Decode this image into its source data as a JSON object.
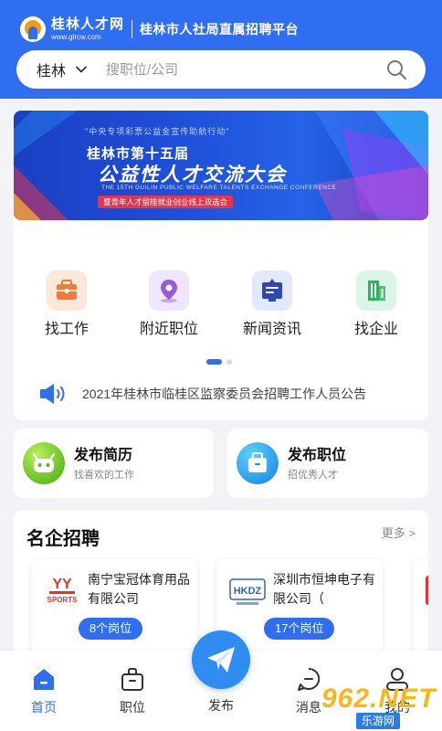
{
  "header": {
    "logo_name": "桂林人才网",
    "logo_url": "www.glrcw.com",
    "slogan": "桂林市人社局直属招聘平台",
    "city": "桂林",
    "search_placeholder": "搜职位/公司"
  },
  "banner": {
    "top_text": "\"中央专项彩票公益金宣传助航行动\"",
    "title_line1": "桂林市第十五届",
    "title_line2": "公益性人才交流大会",
    "english": "THE 15TH GUILIN PUBLIC WELFARE TALENTS EXCHANGE CONFERENCE",
    "tag": "暨青年人才留桂就业创业线上双选会"
  },
  "quick_links": [
    {
      "label": "找工作",
      "icon": "briefcase-icon"
    },
    {
      "label": "附近职位",
      "icon": "location-pin-icon"
    },
    {
      "label": "新闻资讯",
      "icon": "news-icon"
    },
    {
      "label": "找企业",
      "icon": "building-icon"
    }
  ],
  "notice": {
    "icon": "speaker-icon",
    "text": "2021年桂林市临桂区监察委员会招聘工作人员公告"
  },
  "publish": [
    {
      "title": "发布简历",
      "subtitle": "找喜欢的工作"
    },
    {
      "title": "发布职位",
      "subtitle": "招优秀人才"
    }
  ],
  "famous": {
    "title": "名企招聘",
    "more": "更多 >",
    "companies": [
      {
        "name": "南宁宝冠体育用品有限公司",
        "jobs": "8个岗位"
      },
      {
        "name": "深圳市恒坤电子有限公司（",
        "jobs": "17个岗位"
      }
    ]
  },
  "nav": {
    "items": [
      "首页",
      "职位",
      "发布",
      "消息",
      "我的"
    ],
    "active": "首页"
  },
  "watermark": {
    "main": "962.NET",
    "sub": "乐游网"
  },
  "colors": {
    "primary": "#2f6df1",
    "fab": "#2f8df1"
  }
}
